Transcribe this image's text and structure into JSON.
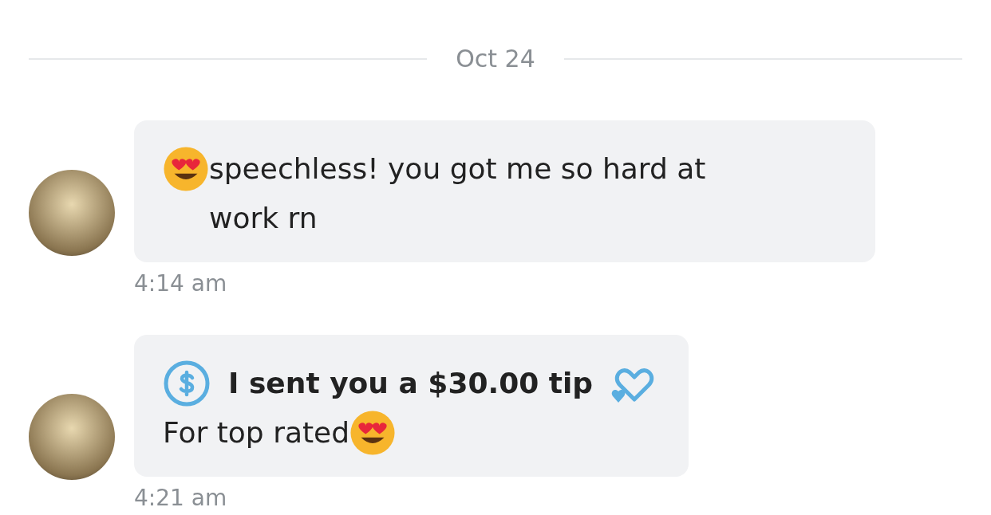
{
  "date_divider": "Oct 24",
  "messages": [
    {
      "kind": "text",
      "parts": [
        {
          "kind": "emoji"
        },
        {
          "kind": "text",
          "text": "speechless! you got me so hard at work rn"
        }
      ],
      "time": "4:14 am"
    },
    {
      "kind": "tip",
      "tip_label": "I sent you a $30.00 tip",
      "parts": [
        {
          "kind": "text",
          "text": "For top rated"
        },
        {
          "kind": "emoji"
        }
      ],
      "time": "4:21 am"
    }
  ]
}
